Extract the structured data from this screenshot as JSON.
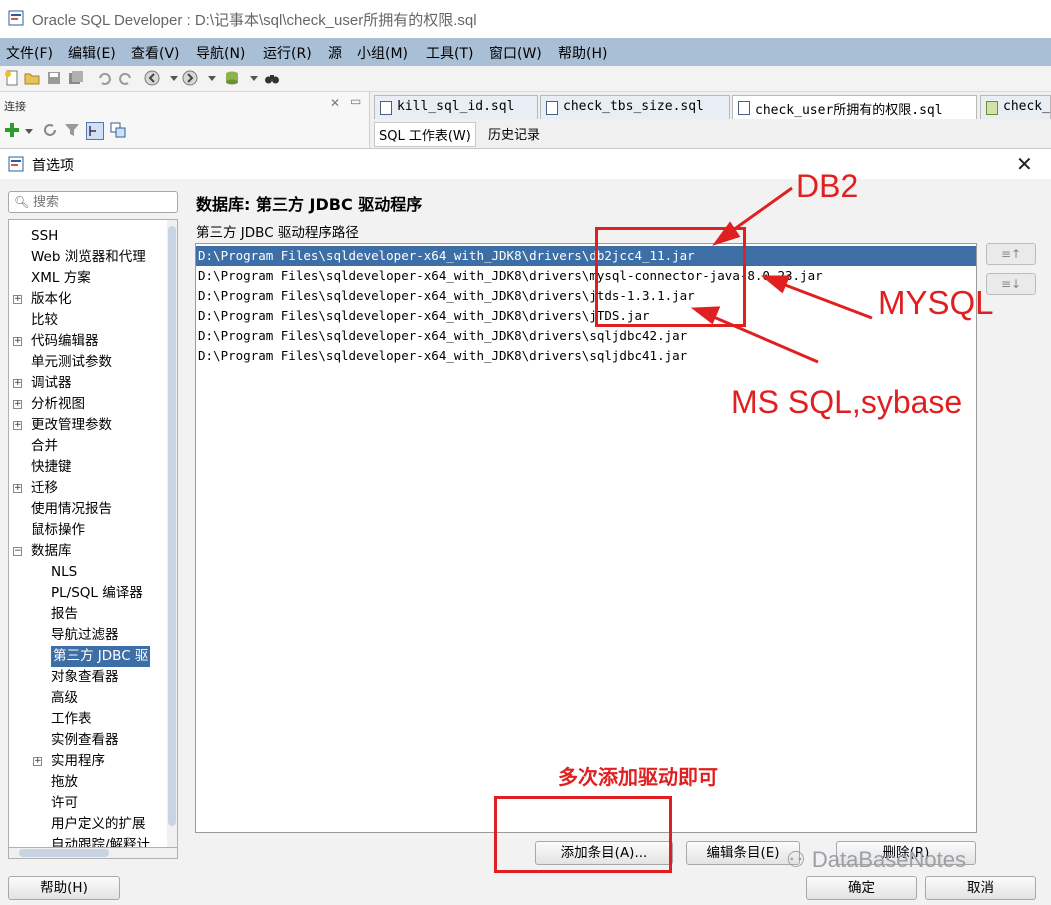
{
  "window": {
    "title": "Oracle SQL Developer : D:\\记事本\\sql\\check_user所拥有的权限.sql"
  },
  "menu": [
    "文件(F)",
    "编辑(E)",
    "查看(V)",
    "导航(N)",
    "运行(R)",
    "源",
    "小组(M)",
    "工具(T)",
    "窗口(W)",
    "帮助(H)"
  ],
  "connections_panel": {
    "title": "连接"
  },
  "editor": {
    "tabs": [
      {
        "label": "kill_sql_id.sql",
        "active": false
      },
      {
        "label": "check_tbs_size.sql",
        "active": false
      },
      {
        "label": "check_user所拥有的权限.sql",
        "active": true
      },
      {
        "label": "check_",
        "active": false
      }
    ],
    "sub_tabs": [
      "SQL 工作表(W)",
      "历史记录"
    ]
  },
  "dialog": {
    "title": "首选项",
    "search_placeholder": "搜索",
    "tree": [
      {
        "label": "SSH",
        "level": 0,
        "expandable": false
      },
      {
        "label": "Web 浏览器和代理",
        "level": 0,
        "expandable": false
      },
      {
        "label": "XML 方案",
        "level": 0,
        "expandable": false
      },
      {
        "label": "版本化",
        "level": 0,
        "expandable": true
      },
      {
        "label": "比较",
        "level": 0,
        "expandable": false
      },
      {
        "label": "代码编辑器",
        "level": 0,
        "expandable": true
      },
      {
        "label": "单元测试参数",
        "level": 0,
        "expandable": false
      },
      {
        "label": "调试器",
        "level": 0,
        "expandable": true
      },
      {
        "label": "分析视图",
        "level": 0,
        "expandable": true
      },
      {
        "label": "更改管理参数",
        "level": 0,
        "expandable": true
      },
      {
        "label": "合并",
        "level": 0,
        "expandable": false
      },
      {
        "label": "快捷键",
        "level": 0,
        "expandable": false
      },
      {
        "label": "迁移",
        "level": 0,
        "expandable": true
      },
      {
        "label": "使用情况报告",
        "level": 0,
        "expandable": false
      },
      {
        "label": "鼠标操作",
        "level": 0,
        "expandable": false
      },
      {
        "label": "数据库",
        "level": 0,
        "expandable": true,
        "expanded": true
      },
      {
        "label": "NLS",
        "level": 1,
        "expandable": false
      },
      {
        "label": "PL/SQL 编译器",
        "level": 1,
        "expandable": false
      },
      {
        "label": "报告",
        "level": 1,
        "expandable": false
      },
      {
        "label": "导航过滤器",
        "level": 1,
        "expandable": false
      },
      {
        "label": "第三方 JDBC 驱",
        "level": 1,
        "expandable": false,
        "selected": true
      },
      {
        "label": "对象查看器",
        "level": 1,
        "expandable": false
      },
      {
        "label": "高级",
        "level": 1,
        "expandable": false
      },
      {
        "label": "工作表",
        "level": 1,
        "expandable": false
      },
      {
        "label": "实例查看器",
        "level": 1,
        "expandable": false
      },
      {
        "label": "实用程序",
        "level": 1,
        "expandable": true
      },
      {
        "label": "拖放",
        "level": 1,
        "expandable": false
      },
      {
        "label": "许可",
        "level": 1,
        "expandable": false
      },
      {
        "label": "用户定义的扩展",
        "level": 1,
        "expandable": false
      },
      {
        "label": "自动跟踪/解释计",
        "level": 1,
        "expandable": false
      }
    ],
    "section_title": "数据库: 第三方 JDBC 驱动程序",
    "path_label": "第三方 JDBC 驱动程序路径",
    "driver_paths": [
      {
        "path": "D:\\Program Files\\sqldeveloper-x64_with_JDK8\\drivers\\db2jcc4_11.jar",
        "selected": true
      },
      {
        "path": "D:\\Program Files\\sqldeveloper-x64_with_JDK8\\drivers\\mysql-connector-java-8.0.23.jar",
        "selected": false
      },
      {
        "path": "D:\\Program Files\\sqldeveloper-x64_with_JDK8\\drivers\\jtds-1.3.1.jar",
        "selected": false
      },
      {
        "path": "D:\\Program Files\\sqldeveloper-x64_with_JDK8\\drivers\\jTDS.jar",
        "selected": false
      },
      {
        "path": "D:\\Program Files\\sqldeveloper-x64_with_JDK8\\drivers\\sqljdbc42.jar",
        "selected": false
      },
      {
        "path": "D:\\Program Files\\sqldeveloper-x64_with_JDK8\\drivers\\sqljdbc41.jar",
        "selected": false
      }
    ],
    "side_buttons": {
      "move_up": "≡↑",
      "move_down": "≡↓"
    },
    "buttons": {
      "add": "添加条目(A)...",
      "edit": "编辑条目(E)",
      "delete": "删除(R)",
      "help": "帮助(H)",
      "ok": "确定",
      "cancel": "取消"
    }
  },
  "annotations": {
    "db2": "DB2",
    "mysql": "MYSQL",
    "mssql": "MS SQL,sybase",
    "add_hint": "多次添加驱动即可",
    "color": "#e02020"
  },
  "watermark": "DataBaseNotes"
}
